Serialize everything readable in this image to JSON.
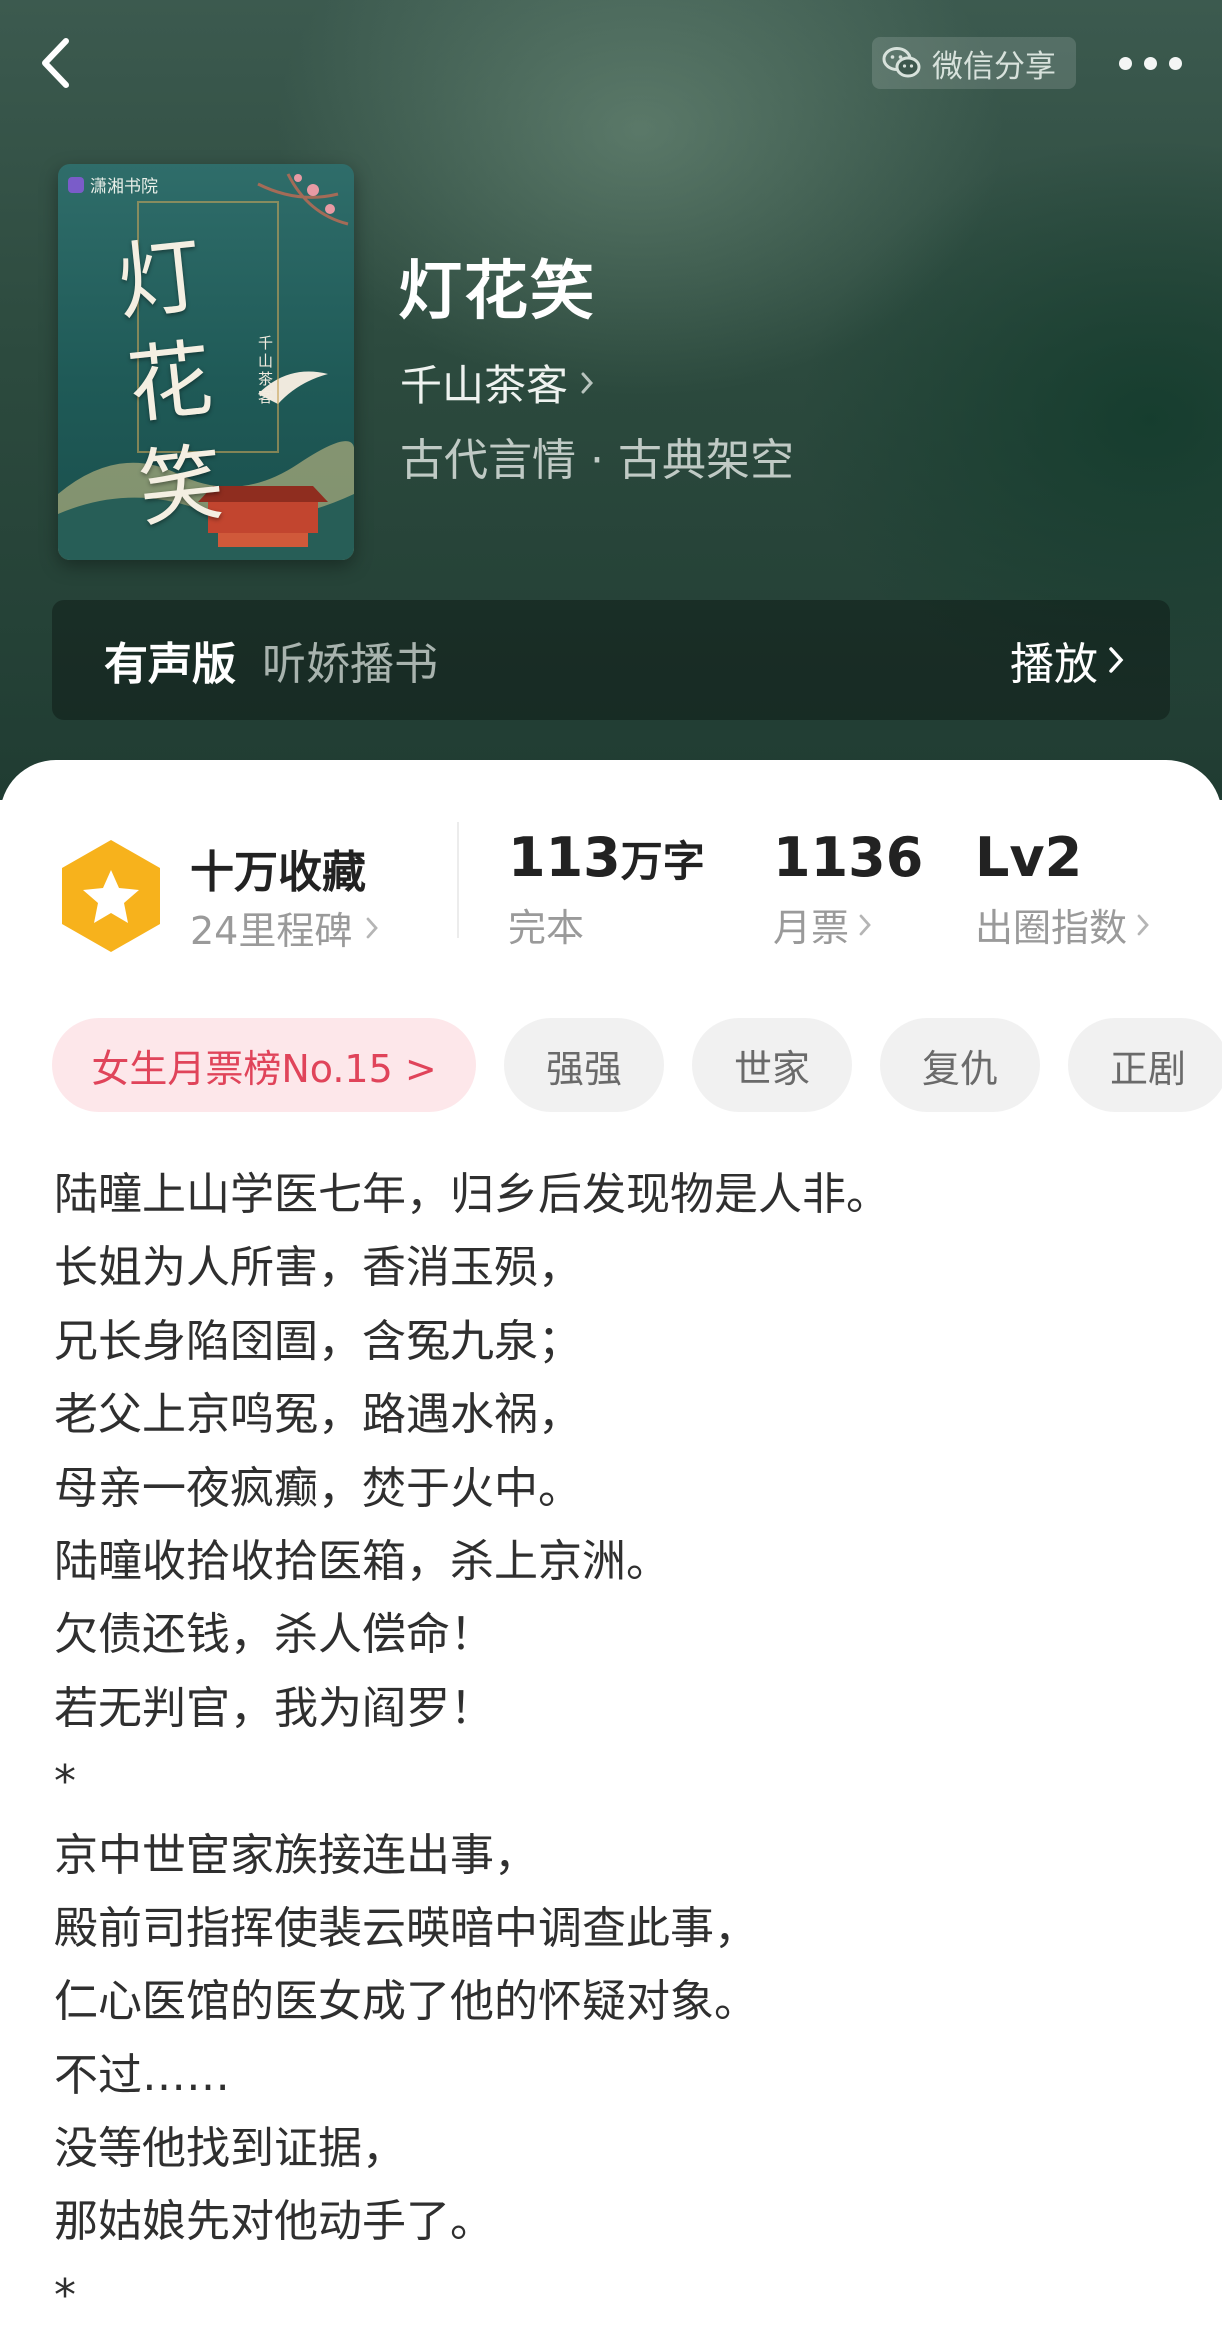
{
  "nav": {
    "back_icon": "chevron-left-icon",
    "share_label": "微信分享",
    "share_icon": "wechat-icon",
    "more_icon": "more-dots-icon"
  },
  "book": {
    "cover": {
      "publisher": "潇湘书院",
      "title_art": "灯花笑",
      "author_tag": "千山茶客"
    },
    "title": "灯花笑",
    "author": "千山茶客",
    "genre": "古代言情 · 古典架空"
  },
  "audio": {
    "label": "有声版",
    "narrator": "听娇播书",
    "play_label": "播放"
  },
  "stats": {
    "collect_main": "十万收藏",
    "collect_sub": "24里程碑",
    "words_value": "113",
    "words_unit": "万字",
    "words_label": "完本",
    "tickets_value": "1136",
    "tickets_label": "月票",
    "level_value": "Lv2",
    "level_label": "出圈指数"
  },
  "tags": {
    "rank": "女生月票榜No.15 >",
    "items": [
      "强强",
      "世家",
      "复仇",
      "正剧"
    ]
  },
  "synopsis": [
    "陆曈上山学医七年，归乡后发现物是人非。",
    "长姐为人所害，香消玉殒，",
    "兄长身陷囹圄，含冤九泉；",
    "老父上京鸣冤，路遇水祸，",
    "母亲一夜疯癫，焚于火中。",
    "陆曈收拾收拾医箱，杀上京洲。",
    "欠债还钱，杀人偿命！",
    "若无判官，我为阎罗！",
    "*",
    "京中世宦家族接连出事，",
    "殿前司指挥使裴云暎暗中调查此事，",
    "仁心医馆的医女成了他的怀疑对象。",
    "不过……",
    "没等他找到证据，",
    "那姑娘先对他动手了。",
    "*"
  ],
  "colors": {
    "hero_bg": "#2c4a3e",
    "rank_tag_text": "#e0445a",
    "rank_tag_bg": "#fde7ea",
    "badge": "#f7b21c"
  }
}
